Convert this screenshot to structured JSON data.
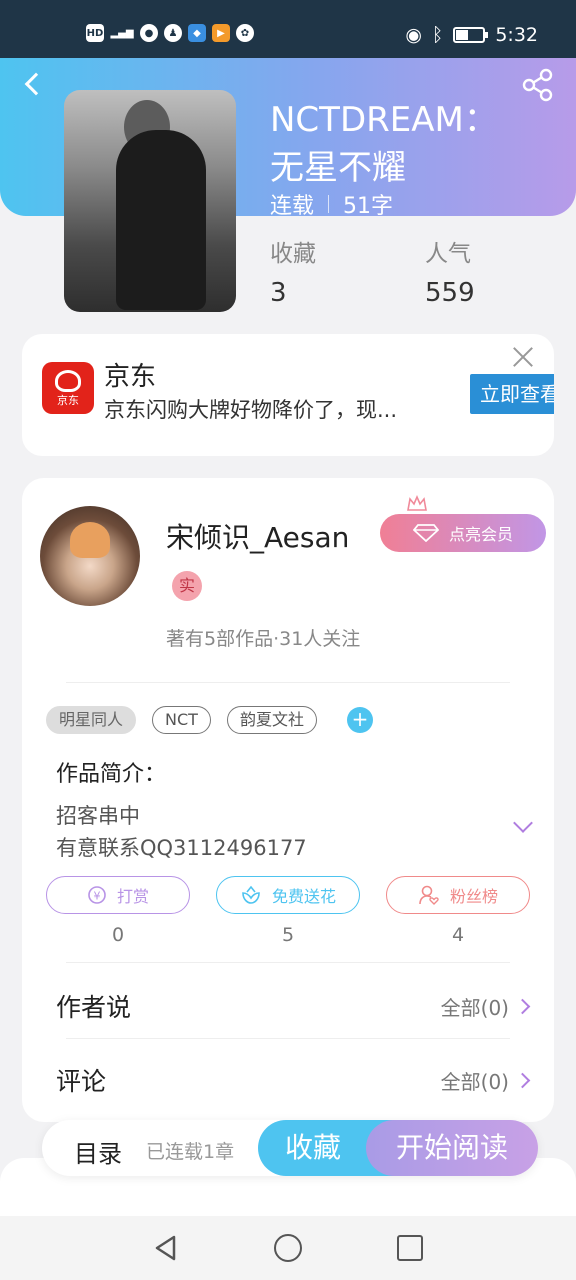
{
  "status_bar": {
    "time": "5:32",
    "left_icons": [
      "hd-icon",
      "signal-icon",
      "browser-icon",
      "qq-icon",
      "app-icon",
      "video-icon",
      "wechat-icon"
    ],
    "right_icons": [
      "eye-icon",
      "bluetooth-icon",
      "battery-icon"
    ]
  },
  "book": {
    "title_line1": "NCTDREAM：",
    "title_line2": "无星不耀",
    "status": "连载",
    "word_count": "51字",
    "favorites_label": "收藏",
    "favorites_value": "3",
    "popularity_label": "人气",
    "popularity_value": "559"
  },
  "ad": {
    "logo_text": "京东",
    "title": "京东",
    "description": "京东闪购大牌好物降价了，现...",
    "cta": "立即查看"
  },
  "author": {
    "name": "宋倾识_Aesan",
    "vip_label": "点亮会员",
    "badge": "实",
    "stats": "著有5部作品·31人关注"
  },
  "tags": [
    "明星同人",
    "NCT",
    "韵夏文社"
  ],
  "intro": {
    "title": "作品简介：",
    "line1": "招客串中",
    "line2": "有意联系QQ3112496177"
  },
  "actions": [
    {
      "label": "打赏",
      "count": "0",
      "color": "#b894e6"
    },
    {
      "label": "免费送花",
      "count": "5",
      "color": "#4ec4f0"
    },
    {
      "label": "粉丝榜",
      "count": "4",
      "color": "#f08a8a"
    }
  ],
  "rows": {
    "author_say": {
      "title": "作者说",
      "value": "全部(0)"
    },
    "comments": {
      "title": "评论",
      "value": "全部(0)"
    }
  },
  "bottom_bar": {
    "toc": "目录",
    "toc_sub": "已连载1章",
    "favorite": "收藏",
    "read": "开始阅读"
  }
}
